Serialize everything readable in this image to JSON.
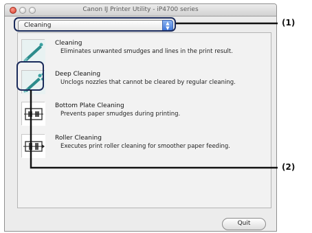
{
  "window": {
    "title": "Canon IJ Printer Utility - iP4700 series"
  },
  "popup": {
    "selected": "Cleaning"
  },
  "items": [
    {
      "title": "Cleaning",
      "desc": "Eliminates unwanted smudges and lines in the print result.",
      "icon": "cleaning-icon"
    },
    {
      "title": "Deep Cleaning",
      "desc": "Unclogs nozzles that cannot be cleared by regular cleaning.",
      "icon": "deep-cleaning-icon"
    },
    {
      "title": "Bottom Plate Cleaning",
      "desc": "Prevents paper smudges during printing.",
      "icon": "bottom-plate-cleaning-icon"
    },
    {
      "title": "Roller Cleaning",
      "desc": "Executes print roller cleaning for smoother paper feeding.",
      "icon": "roller-cleaning-icon"
    }
  ],
  "buttons": {
    "quit": "Quit"
  },
  "callouts": {
    "one": "(1)",
    "two": "(2)"
  }
}
